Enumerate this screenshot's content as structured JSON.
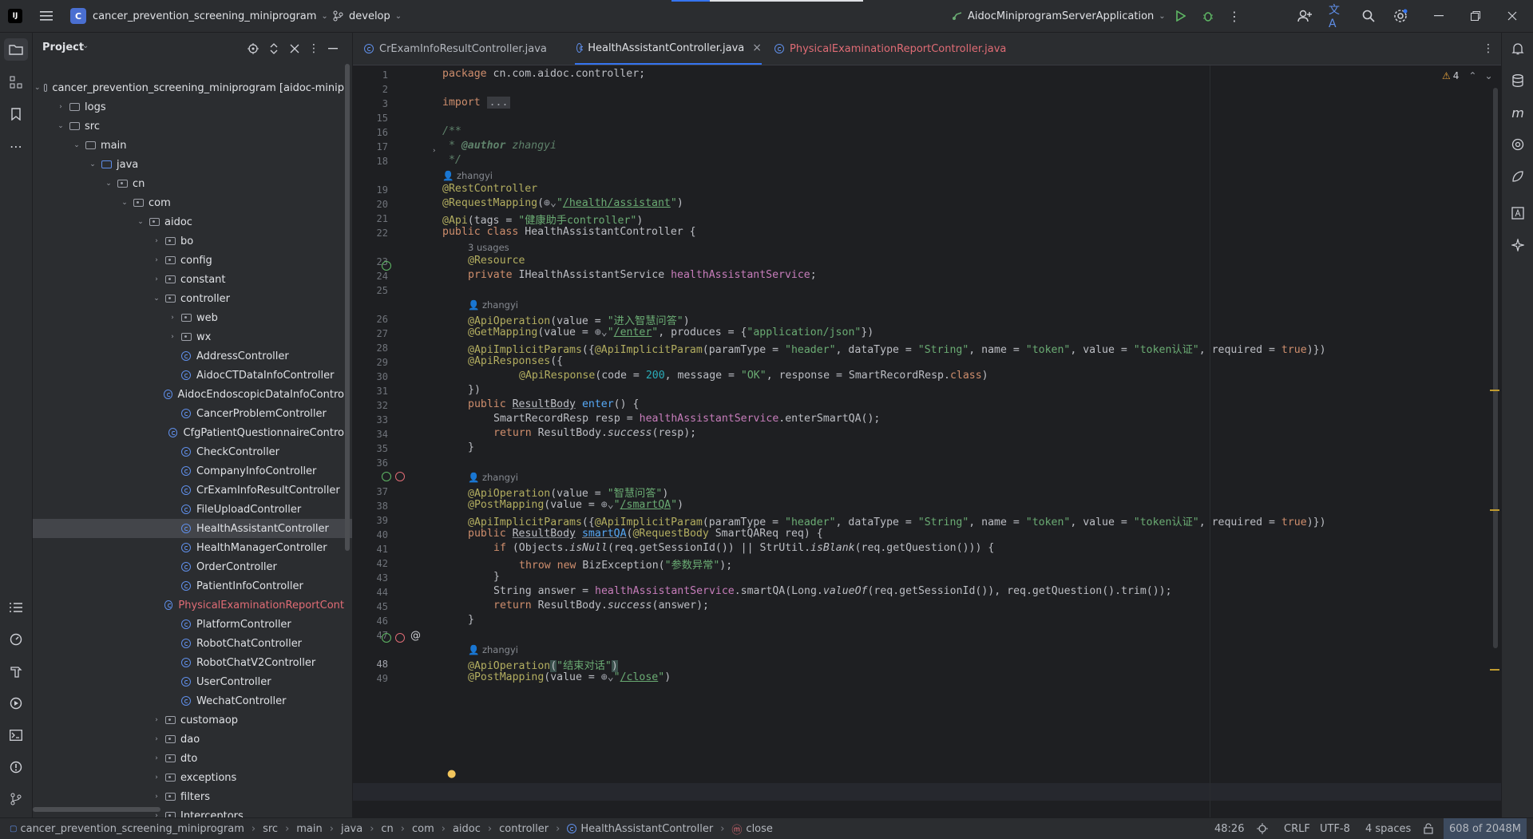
{
  "titlebar": {
    "project_badge": "C",
    "project_name": "cancer_prevention_screening_miniprogram",
    "branch": "develop",
    "run_config": "AidocMiniprogramServerApplication"
  },
  "project_panel": {
    "title": "Project",
    "tree": [
      {
        "label": "cancer_prevention_screening_miniprogram [aidoc-minip",
        "kind": "module",
        "depth": 0,
        "expanded": true
      },
      {
        "label": "logs",
        "kind": "folder",
        "depth": 1,
        "expanded": false
      },
      {
        "label": "src",
        "kind": "folder",
        "depth": 1,
        "expanded": true
      },
      {
        "label": "main",
        "kind": "folder",
        "depth": 2,
        "expanded": true
      },
      {
        "label": "java",
        "kind": "folder",
        "depth": 3,
        "expanded": true
      },
      {
        "label": "cn",
        "kind": "package",
        "depth": 4,
        "expanded": true
      },
      {
        "label": "com",
        "kind": "package",
        "depth": 5,
        "expanded": true
      },
      {
        "label": "aidoc",
        "kind": "package",
        "depth": 6,
        "expanded": true
      },
      {
        "label": "bo",
        "kind": "package",
        "depth": 7,
        "expanded": false
      },
      {
        "label": "config",
        "kind": "package",
        "depth": 7,
        "expanded": false
      },
      {
        "label": "constant",
        "kind": "package",
        "depth": 7,
        "expanded": false
      },
      {
        "label": "controller",
        "kind": "package",
        "depth": 7,
        "expanded": true
      },
      {
        "label": "web",
        "kind": "package",
        "depth": 8,
        "expanded": false
      },
      {
        "label": "wx",
        "kind": "package",
        "depth": 8,
        "expanded": false
      },
      {
        "label": "AddressController",
        "kind": "class",
        "depth": 8
      },
      {
        "label": "AidocCTDataInfoController",
        "kind": "class",
        "depth": 8
      },
      {
        "label": "AidocEndoscopicDataInfoContro",
        "kind": "class",
        "depth": 8
      },
      {
        "label": "CancerProblemController",
        "kind": "class",
        "depth": 8
      },
      {
        "label": "CfgPatientQuestionnaireContro",
        "kind": "class",
        "depth": 8
      },
      {
        "label": "CheckController",
        "kind": "class",
        "depth": 8
      },
      {
        "label": "CompanyInfoController",
        "kind": "class",
        "depth": 8
      },
      {
        "label": "CrExamInfoResultController",
        "kind": "class",
        "depth": 8
      },
      {
        "label": "FileUploadController",
        "kind": "class",
        "depth": 8
      },
      {
        "label": "HealthAssistantController",
        "kind": "class",
        "depth": 8,
        "selected": true
      },
      {
        "label": "HealthManagerController",
        "kind": "class",
        "depth": 8
      },
      {
        "label": "OrderController",
        "kind": "class",
        "depth": 8
      },
      {
        "label": "PatientInfoController",
        "kind": "class",
        "depth": 8
      },
      {
        "label": "PhysicalExaminationReportCont",
        "kind": "class",
        "depth": 8,
        "error": true
      },
      {
        "label": "PlatformController",
        "kind": "class",
        "depth": 8
      },
      {
        "label": "RobotChatController",
        "kind": "class",
        "depth": 8
      },
      {
        "label": "RobotChatV2Controller",
        "kind": "class",
        "depth": 8
      },
      {
        "label": "UserController",
        "kind": "class",
        "depth": 8
      },
      {
        "label": "WechatController",
        "kind": "class",
        "depth": 8
      },
      {
        "label": "customaop",
        "kind": "package",
        "depth": 7,
        "expanded": false
      },
      {
        "label": "dao",
        "kind": "package",
        "depth": 7,
        "expanded": false
      },
      {
        "label": "dto",
        "kind": "package",
        "depth": 7,
        "expanded": false
      },
      {
        "label": "exceptions",
        "kind": "package",
        "depth": 7,
        "expanded": false
      },
      {
        "label": "filters",
        "kind": "package",
        "depth": 7,
        "expanded": false
      },
      {
        "label": "Interceptors",
        "kind": "package",
        "depth": 7,
        "expanded": false
      }
    ]
  },
  "tabs": [
    {
      "label": "CrExamInfoResultController.java",
      "active": false
    },
    {
      "label": "HealthAssistantController.java",
      "active": true,
      "close": "×"
    },
    {
      "label": "PhysicalExaminationReportController.java",
      "active": false,
      "error": true
    }
  ],
  "editor": {
    "warnings_count": "4",
    "lines": [
      {
        "n": "1"
      },
      {
        "n": "2"
      },
      {
        "n": "3"
      },
      {
        "n": "15"
      },
      {
        "n": "16"
      },
      {
        "n": "17"
      },
      {
        "n": "18"
      },
      {
        "n": "",
        "hint": "zhangyi"
      },
      {
        "n": "19"
      },
      {
        "n": "20"
      },
      {
        "n": "21"
      },
      {
        "n": "22"
      },
      {
        "n": "",
        "hint": "3 usages"
      },
      {
        "n": "23"
      },
      {
        "n": "24"
      },
      {
        "n": "25"
      },
      {
        "n": "",
        "hint": "zhangyi"
      },
      {
        "n": "26"
      },
      {
        "n": "27"
      },
      {
        "n": "28"
      },
      {
        "n": "29"
      },
      {
        "n": "30"
      },
      {
        "n": "31"
      },
      {
        "n": "32"
      },
      {
        "n": "33"
      },
      {
        "n": "34"
      },
      {
        "n": "35"
      },
      {
        "n": "36"
      },
      {
        "n": "",
        "hint": "zhangyi"
      },
      {
        "n": "37"
      },
      {
        "n": "38"
      },
      {
        "n": "39"
      },
      {
        "n": "40"
      },
      {
        "n": "41"
      },
      {
        "n": "42"
      },
      {
        "n": "43"
      },
      {
        "n": "44"
      },
      {
        "n": "45"
      },
      {
        "n": "46"
      },
      {
        "n": "47"
      },
      {
        "n": "",
        "hint": "zhangyi"
      },
      {
        "n": "48"
      },
      {
        "n": "49"
      }
    ],
    "code": {
      "l1_kw": "package",
      "l1_rest": " cn.com.aidoc.controller;",
      "l3_kw": "import",
      "l3_fold": "...",
      "l16": "/**",
      "l17_a": " * ",
      "l17_tag": "@author",
      "l17_b": " zhangyi",
      "l18": " */",
      "l19": "@RestController",
      "l20_an": "@RequestMapping",
      "l20_url": "/health/assistant",
      "l21_an": "@Api",
      "l21_a": "(tags = ",
      "l21_str": "\"健康助手controller\"",
      "l22_kw1": "public",
      "l22_kw2": "class",
      "l22_name": "HealthAssistantController {",
      "l23": "@Resource",
      "l24_kw": "private",
      "l24_type": " IHealthAssistantService ",
      "l24_fld": "healthAssistantService",
      "l26_an": "@ApiOperation",
      "l26_a": "(value = ",
      "l26_str": "\"进入智慧问答\"",
      "l27_an": "@GetMapping",
      "l27_url": "/enter",
      "l27_a": ", produces = {",
      "l27_str": "\"application/json\"",
      "l28_an": "@ApiImplicitParams",
      "l28_an2": "@ApiImplicitParam",
      "l28_a": "(paramType = ",
      "l28_s1": "\"header\"",
      "l28_b": ", dataType = ",
      "l28_s2": "\"String\"",
      "l28_c": ", name = ",
      "l28_s3": "\"token\"",
      "l28_d": ", value = ",
      "l28_s4": "\"token认证\"",
      "l28_e": ", required = ",
      "l28_kw": "true",
      "l29_an": "@ApiResponses",
      "l30_an": "@ApiResponse",
      "l30_a": "(code = ",
      "l30_num": "200",
      "l30_b": ", message = ",
      "l30_str": "\"OK\"",
      "l30_c": ", response = SmartRecordResp.",
      "l30_kw": "class",
      "l31": "})",
      "l32_kw": "public",
      "l32_type": "ResultBody",
      "l32_m": "enter",
      "l33_a": "SmartRecordResp resp = ",
      "l33_fld": "healthAssistantService",
      "l33_b": ".enterSmartQA();",
      "l34_kw": "return",
      "l34_a": " ResultBody.",
      "l34_it": "success",
      "l34_b": "(resp);",
      "l35": "}",
      "l37_an": "@ApiOperation",
      "l37_a": "(value = ",
      "l37_str": "\"智慧问答\"",
      "l38_an": "@PostMapping",
      "l38_url": "/smartQA",
      "l40_kw": "public",
      "l40_type": "ResultBody",
      "l40_m": "smartQA",
      "l40_an": "@RequestBody",
      "l40_a": " SmartQAReq req) {",
      "l41_kw": "if",
      "l41_a": " (Objects.",
      "l41_it": "isNull",
      "l41_b": "(req.getSessionId()) || StrUtil.",
      "l41_it2": "isBlank",
      "l41_c": "(req.getQuestion())) {",
      "l42_kw": "throw new",
      "l42_a": " BizException(",
      "l42_str": "\"参数异常\"",
      "l42_b": ");",
      "l43": "}",
      "l44_a": "String answer = ",
      "l44_fld": "healthAssistantService",
      "l44_b": ".smartQA(Long.",
      "l44_it": "valueOf",
      "l44_c": "(req.getSessionId()), req.getQuestion().trim());",
      "l45_kw": "return",
      "l45_a": " ResultBody.",
      "l45_it": "success",
      "l45_b": "(answer);",
      "l46": "}",
      "l48_an": "@ApiOperation",
      "l48_str": "\"结束对话\"",
      "l49_an": "@PostMapping",
      "l49_url": "/close"
    }
  },
  "statusbar": {
    "breadcrumb": [
      "cancer_prevention_screening_miniprogram",
      "src",
      "main",
      "java",
      "cn",
      "com",
      "aidoc",
      "controller",
      "HealthAssistantController",
      "close"
    ],
    "position": "48:26",
    "line_sep": "CRLF",
    "encoding": "UTF-8",
    "indent": "4 spaces",
    "memory": "608 of 2048M"
  },
  "colors": {
    "accent": "#3574f0",
    "error": "#e06c75",
    "keyword": "#cf8e6d",
    "string": "#6aab73",
    "annotation": "#b3ae60"
  }
}
